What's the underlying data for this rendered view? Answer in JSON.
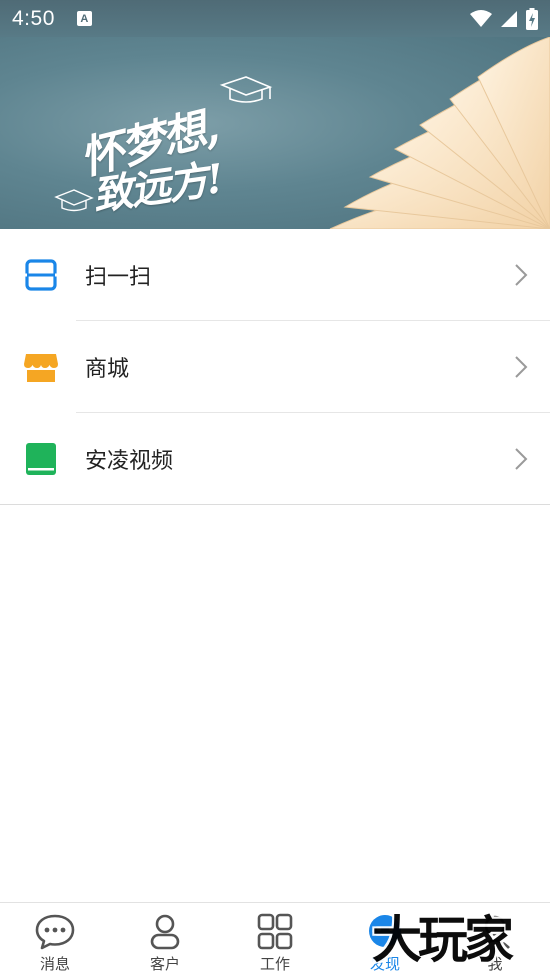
{
  "status_bar": {
    "time": "4:50",
    "indicator": "A"
  },
  "banner": {
    "line1": "怀梦想,",
    "line2": "致远方!"
  },
  "menu": {
    "items": [
      {
        "label": "扫一扫",
        "icon": "scan-icon"
      },
      {
        "label": "商城",
        "icon": "shop-icon"
      },
      {
        "label": "安凌视频",
        "icon": "book-icon"
      }
    ]
  },
  "bottom_nav": {
    "items": [
      {
        "label": "消息",
        "icon": "chat-icon"
      },
      {
        "label": "客户",
        "icon": "user-icon"
      },
      {
        "label": "工作",
        "icon": "grid-icon"
      },
      {
        "label": "发现",
        "icon": "discover-icon",
        "active": true
      },
      {
        "label": "我",
        "icon": "profile-icon"
      }
    ]
  },
  "colors": {
    "accent": "#1a86e8",
    "scan": "#1a86e8",
    "shop": "#f5a623",
    "book": "#1fb35a"
  },
  "watermark": "大玩家"
}
